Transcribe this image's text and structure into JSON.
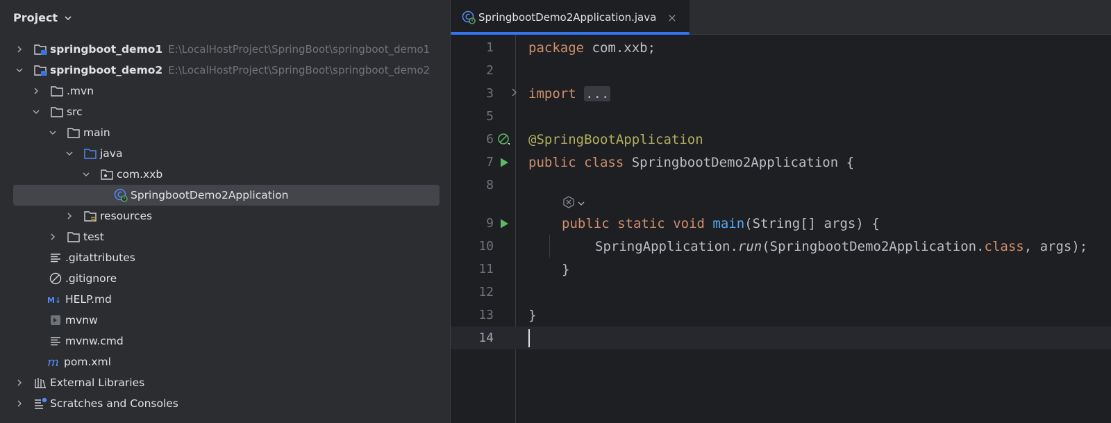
{
  "project_panel": {
    "title": "Project",
    "items": [
      {
        "label": "springboot_demo1",
        "path": "E:\\LocalHostProject\\SpringBoot\\springboot_demo1"
      },
      {
        "label": "springboot_demo2",
        "path": "E:\\LocalHostProject\\SpringBoot\\springboot_demo2"
      },
      {
        "label": ".mvn"
      },
      {
        "label": "src"
      },
      {
        "label": "main"
      },
      {
        "label": "java"
      },
      {
        "label": "com.xxb"
      },
      {
        "label": "SpringbootDemo2Application"
      },
      {
        "label": "resources"
      },
      {
        "label": "test"
      },
      {
        "label": ".gitattributes"
      },
      {
        "label": ".gitignore"
      },
      {
        "label": "HELP.md"
      },
      {
        "label": "mvnw"
      },
      {
        "label": "mvnw.cmd"
      },
      {
        "label": "pom.xml"
      },
      {
        "label": "External Libraries"
      },
      {
        "label": "Scratches and Consoles"
      }
    ]
  },
  "editor": {
    "tab_label": "SpringbootDemo2Application.java",
    "close_glyph": "×",
    "line_numbers": [
      "1",
      "2",
      "3",
      "5",
      "6",
      "7",
      "8",
      "9",
      "10",
      "11",
      "12",
      "13",
      "14"
    ],
    "code": {
      "l1_kw": "package",
      "l1_rest": " com.xxb;",
      "l3_kw": "import",
      "l3_fold": "...",
      "l6_ann": "@SpringBootApplication",
      "l7_kw1": "public",
      "l7_kw2": "class",
      "l7_rest": " SpringbootDemo2Application {",
      "l9_kw1": "public",
      "l9_kw2": "static",
      "l9_kw3": "void",
      "l9_fn": "main",
      "l9_rest": "(String[] args) {",
      "l10_a": "SpringApplication.",
      "l10_run": "run",
      "l10_b": "(SpringbootDemo2Application.",
      "l10_kw": "class",
      "l10_c": ", args);",
      "l11": "}",
      "l13": "}"
    }
  },
  "colors": {
    "accent": "#3574f0",
    "run_green": "#5fb865",
    "keyword": "#cf8e6d",
    "annotation": "#b3ae60"
  }
}
